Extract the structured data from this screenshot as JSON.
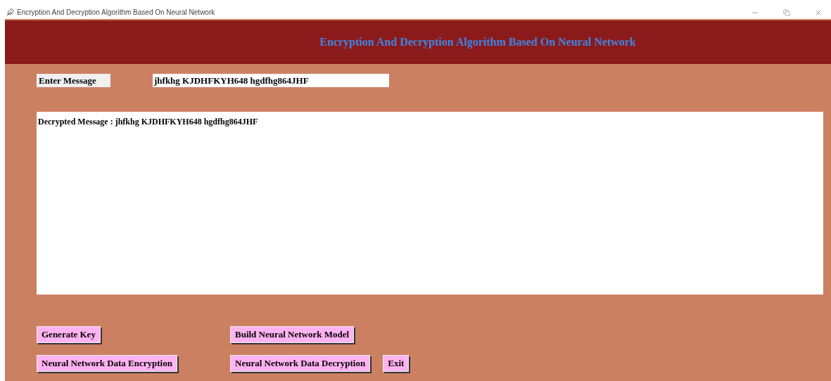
{
  "window": {
    "title": "Encryption And Decryption Algorithm Based On Neural Network"
  },
  "header": {
    "title": "Encryption And Decryption Algorithm Based On Neural Network"
  },
  "message": {
    "label": "Enter Message",
    "value": "jhfkhg KJDHFKYH648 hgdfhg864JHF"
  },
  "output": {
    "text": "Decrypted Message : jhfkhg KJDHFKYH648 hgdfhg864JHF"
  },
  "buttons": [
    [
      "Generate Key",
      "Build Neural Network Model"
    ],
    [
      "Neural Network Data Encryption",
      "Neural Network Data Decryption",
      "Exit"
    ]
  ]
}
